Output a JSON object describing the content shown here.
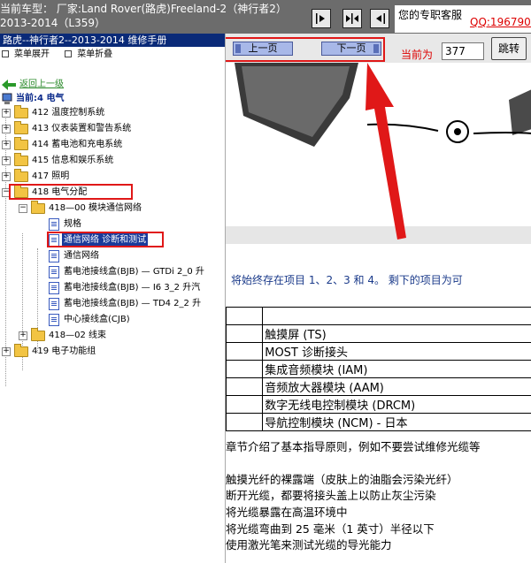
{
  "header": {
    "car_model": "当前车型： 厂家:Land Rover(路虎)Freeland-2（神行者2）2013-2014（L359）",
    "service_label": "您的专职客服",
    "qq": "QQ:19679000"
  },
  "sidebar": {
    "manual_title": "路虎--神行者2--2013-2014 维修手册",
    "menu_expand": "菜单展开",
    "menu_collapse": "菜单折叠",
    "back_link": "返回上一级",
    "current": "当前:4 电气",
    "items": [
      {
        "label": "412 温度控制系统"
      },
      {
        "label": "413 仪表装置和警告系统"
      },
      {
        "label": "414 蓄电池和充电系统"
      },
      {
        "label": "415 信息和娱乐系统"
      },
      {
        "label": "417 照明"
      },
      {
        "label": "418 电气分配"
      },
      {
        "label": "418—00 模块通信网络"
      },
      {
        "label": "规格"
      },
      {
        "label": "通信网络 诊断和测试"
      },
      {
        "label": "通信网络"
      },
      {
        "label": "蓄电池接线盒(BJB) — GTDi 2_0 升"
      },
      {
        "label": "蓄电池接线盒(BJB) — I6 3_2 升汽"
      },
      {
        "label": "蓄电池接线盒(BJB) — TD4 2_2 升"
      },
      {
        "label": "中心接线盒(CJB)"
      },
      {
        "label": "418—02 线束"
      },
      {
        "label": "419 电子功能组"
      }
    ]
  },
  "toolbar": {
    "prev_label": "上一页",
    "next_label": "下一页",
    "current_label": "当前为",
    "page_value": "377",
    "jump_label": "跳转"
  },
  "content": {
    "intro_line": "将始终存在项目 1、2、3 和 4。 剩下的项目为可",
    "modules": [
      "",
      "触摸屏 (TS)",
      "MOST 诊断接头",
      "集成音频模块 (IAM)",
      "音频放大器模块 (AAM)",
      "数字无线电控制模块 (DRCM)",
      "导航控制模块 (NCM) - 日本"
    ],
    "paragraphs": [
      "章节介绍了基本指导原则，例如不要尝试维修光缆等",
      "触摸光纤的裸露端（皮肤上的油脂会污染光纤）",
      "断开光缆，都要将接头盖上以防止灰尘污染",
      "将光缆暴露在高温环境中",
      "将光缆弯曲到 25 毫米（1 英寸）半径以下",
      "使用激光笔来测试光缆的导光能力"
    ]
  }
}
